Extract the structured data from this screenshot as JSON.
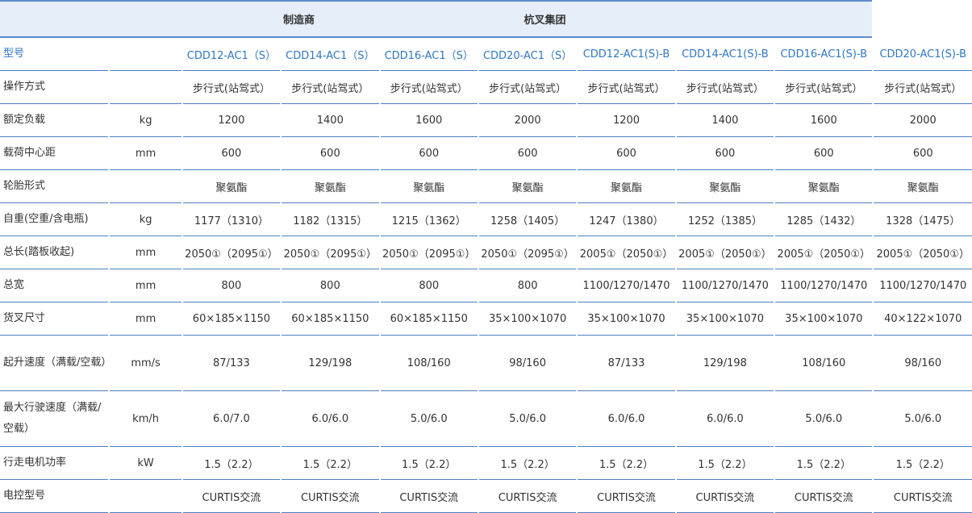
{
  "header": {
    "manufacturer_label": "制造商",
    "manufacturer_value": "杭叉集团"
  },
  "rows": [
    {
      "label": "型号",
      "unit": "",
      "values": [
        "CDD12-AC1（S）",
        "CDD14-AC1（S）",
        "CDD16-AC1（S）",
        "CDD20-AC1（S）",
        "CDD12-AC1(S)-B",
        "CDD14-AC1(S)-B",
        "CDD16-AC1(S)-B",
        "CDD20-AC1(S)-B"
      ]
    },
    {
      "label": "操作方式",
      "unit": "",
      "values": [
        "步行式(站驾式）",
        "步行式(站驾式）",
        "步行式(站驾式）",
        "步行式(站驾式）",
        "步行式(站驾式）",
        "步行式(站驾式）",
        "步行式(站驾式）",
        "步行式(站驾式）"
      ]
    },
    {
      "label": "额定负载",
      "unit": "kg",
      "values": [
        "1200",
        "1400",
        "1600",
        "2000",
        "1200",
        "1400",
        "1600",
        "2000"
      ]
    },
    {
      "label": "载荷中心距",
      "unit": "mm",
      "values": [
        "600",
        "600",
        "600",
        "600",
        "600",
        "600",
        "600",
        "600"
      ]
    },
    {
      "label": "轮胎形式",
      "unit": "",
      "values": [
        "聚氨酯",
        "聚氨酯",
        "聚氨酯",
        "聚氨酯",
        "聚氨酯",
        "聚氨酯",
        "聚氨酯",
        "聚氨酯"
      ]
    },
    {
      "label": "自重(空重/含电瓶)",
      "unit": "kg",
      "values": [
        "1177（1310）",
        "1182（1315）",
        "1215（1362）",
        "1258（1405）",
        "1247（1380）",
        "1252（1385）",
        "1285（1432）",
        "1328（1475）"
      ]
    },
    {
      "label": "总长(踏板收起)",
      "unit": "mm",
      "values": [
        "2050①（2095①）",
        "2050①（2095①）",
        "2050①（2095①）",
        "2050①（2095①）",
        "2005①（2050①）",
        "2005①（2050①）",
        "2005①（2050①）",
        "2005①（2050①）"
      ]
    },
    {
      "label": "总宽",
      "unit": "mm",
      "values": [
        "800",
        "800",
        "800",
        "800",
        "1100/1270/1470",
        "1100/1270/1470",
        "1100/1270/1470",
        "1100/1270/1470"
      ]
    },
    {
      "label": "货叉尺寸",
      "unit": "mm",
      "values": [
        "60×185×1150",
        "60×185×1150",
        "60×185×1150",
        "35×100×1070",
        "35×100×1070",
        "35×100×1070",
        "35×100×1070",
        "40×122×1070"
      ]
    },
    {
      "label": "起升速度（满载/空载）",
      "unit": "mm/s",
      "values": [
        "87/133",
        "129/198",
        "108/160",
        "98/160",
        "87/133",
        "129/198",
        "108/160",
        "98/160"
      ]
    },
    {
      "label": "最大行驶速度（满载/空载）",
      "unit": "km/h",
      "values": [
        "6.0/7.0",
        "6.0/6.0",
        "5.0/6.0",
        "5.0/6.0",
        "6.0/6.0",
        "6.0/6.0",
        "5.0/6.0",
        "5.0/6.0"
      ]
    },
    {
      "label": "行走电机功率",
      "unit": "kW",
      "values": [
        "1.5（2.2）",
        "1.5（2.2）",
        "1.5（2.2）",
        "1.5（2.2）",
        "1.5（2.2）",
        "1.5（2.2）",
        "1.5（2.2）",
        "1.5（2.2）"
      ]
    },
    {
      "label": "电控型号",
      "unit": "",
      "values": [
        "CURTIS交流",
        "CURTIS交流",
        "CURTIS交流",
        "CURTIS交流",
        "CURTIS交流",
        "CURTIS交流",
        "CURTIS交流",
        "CURTIS交流"
      ]
    }
  ],
  "colors": {
    "header_bg": "#e6eefa",
    "rule": "#4d7fbf",
    "model_text": "#2f77c4",
    "body_text": "#333333"
  }
}
